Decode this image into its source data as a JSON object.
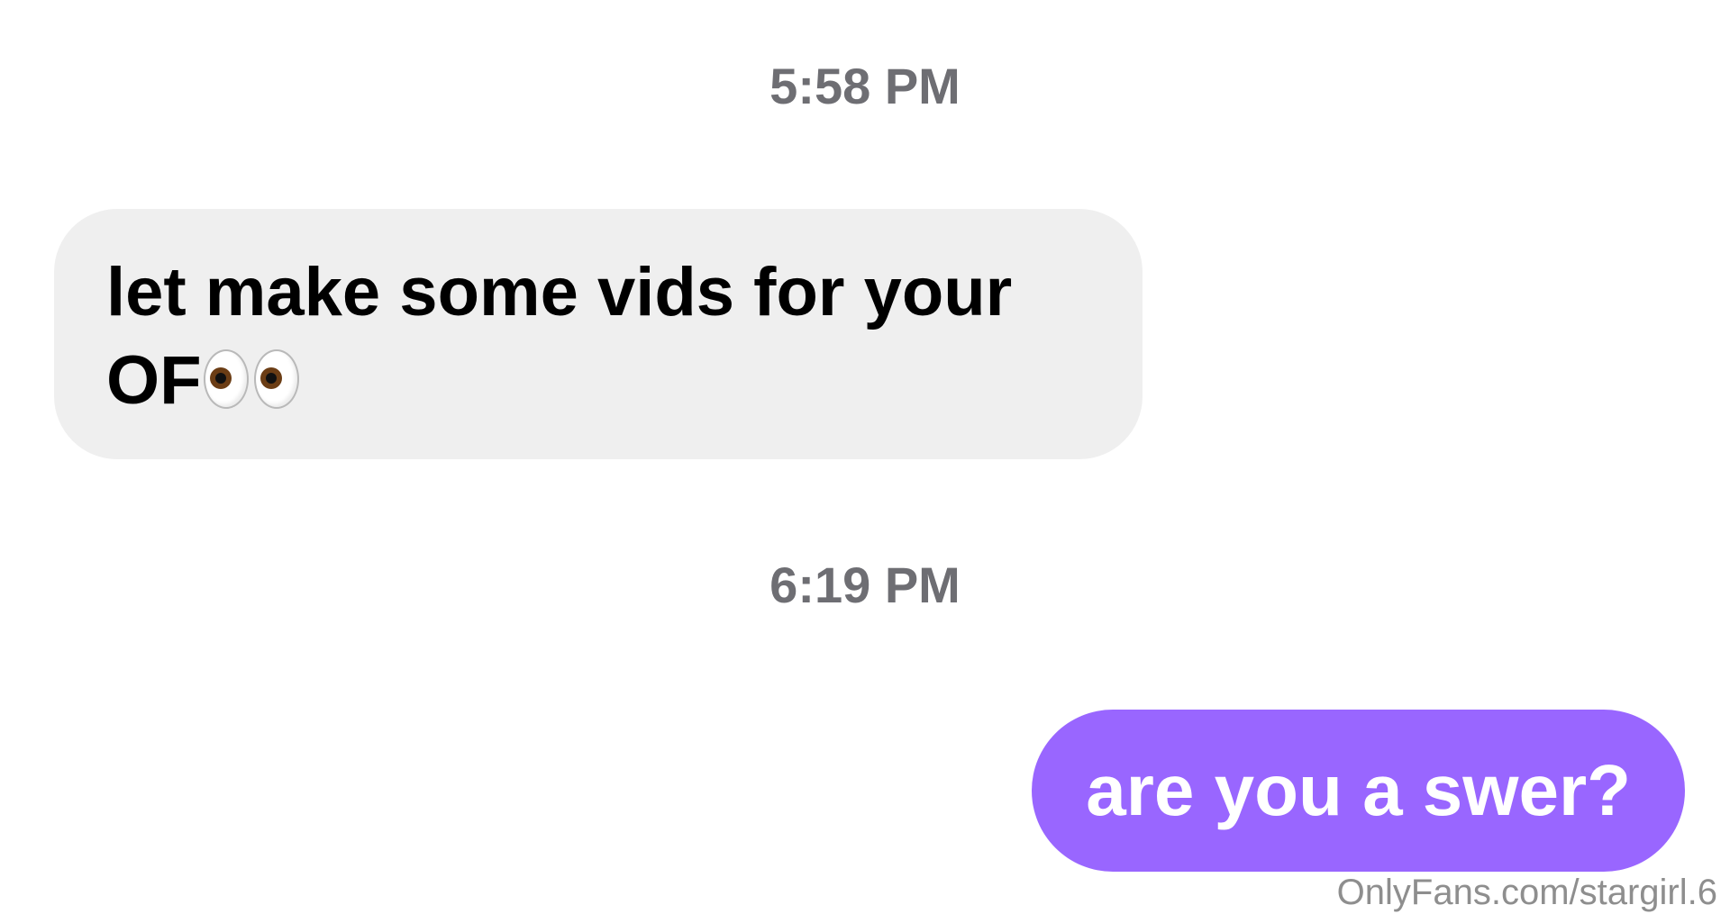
{
  "conversation": {
    "messages": [
      {
        "timestamp": "5:58 PM",
        "direction": "incoming",
        "text": "let make some vids for your OF",
        "emoji": "eyes-emoji"
      },
      {
        "timestamp": "6:19 PM",
        "direction": "outgoing",
        "text": "are you a swer?"
      }
    ]
  },
  "colors": {
    "incoming_bubble": "#efefef",
    "outgoing_bubble": "#9966ff",
    "timestamp": "#6e6e73",
    "watermark": "#8e8e8e"
  },
  "watermark": "OnlyFans.com/stargirl.6"
}
